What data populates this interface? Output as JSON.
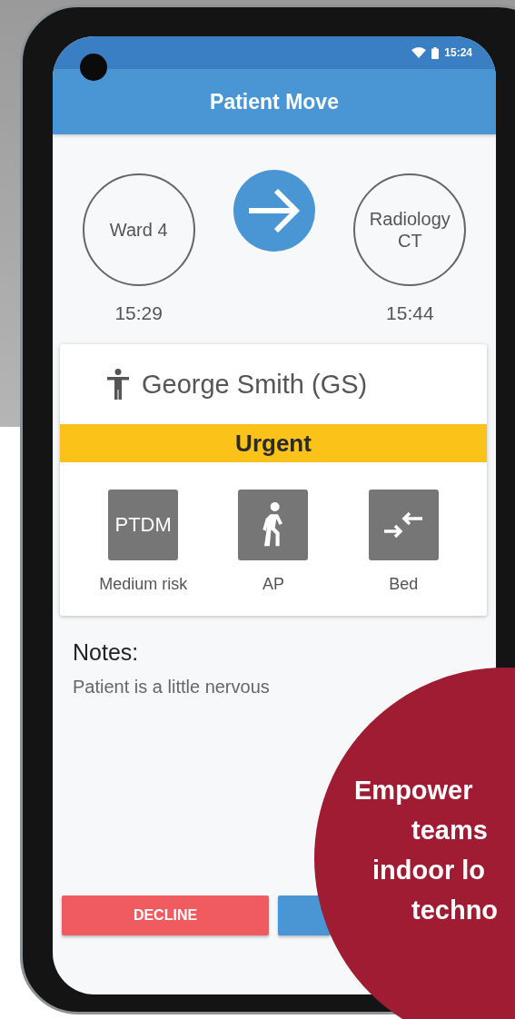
{
  "status_bar": {
    "time": "15:24"
  },
  "app_bar": {
    "title": "Patient Move"
  },
  "route": {
    "from": {
      "name": "Ward 4",
      "time": "15:29"
    },
    "to": {
      "name": "Radiology CT",
      "time": "15:44"
    }
  },
  "patient": {
    "name": "George Smith (GS)",
    "priority": "Urgent",
    "tags": [
      {
        "kind": "text",
        "badge": "PTDM",
        "label": "Medium risk"
      },
      {
        "kind": "walk",
        "label": "AP"
      },
      {
        "kind": "transfer",
        "label": "Bed"
      }
    ]
  },
  "notes": {
    "heading": "Notes:",
    "text": "Patient is a little nervous"
  },
  "buttons": [
    {
      "label": "DECLINE",
      "color": "#ef5b5f"
    },
    {
      "color": "#4a95d3"
    }
  ],
  "promo": {
    "lines": [
      "Empower",
      "teams",
      "indoor lo",
      "techno"
    ]
  }
}
